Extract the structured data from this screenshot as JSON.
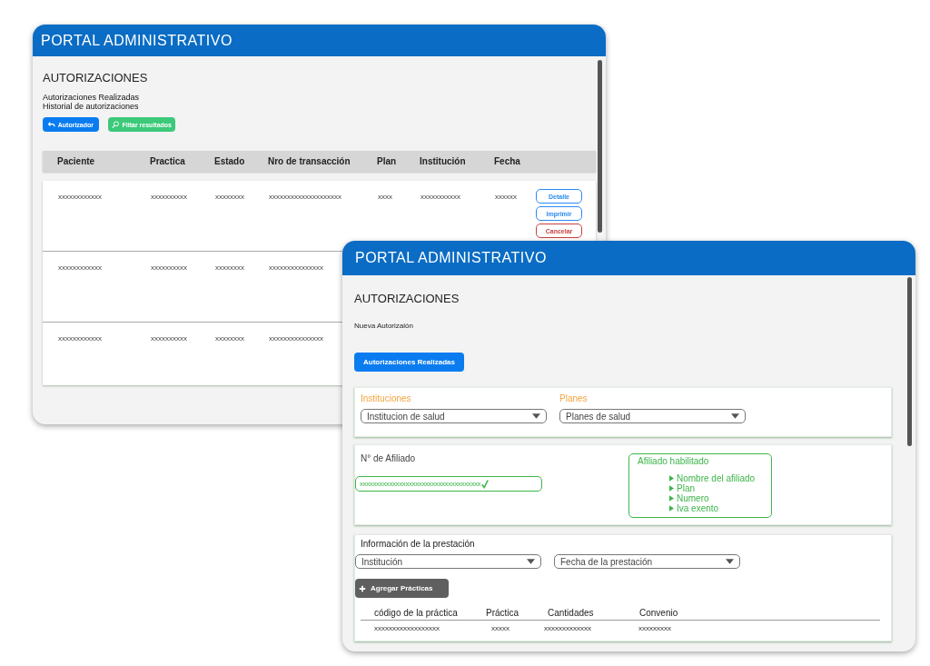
{
  "historial_window": {
    "title": "PORTAL ADMINISTRATIVO",
    "heading": "AUTORIZACIONES",
    "links": [
      "Autorizaciones Realizadas",
      "Historial de autorizaciones"
    ],
    "buttons": [
      {
        "label": "Autorizador",
        "kind": "primary"
      },
      {
        "label": "Filtar resultados",
        "kind": "success"
      }
    ],
    "table": {
      "columns": [
        "Paciente",
        "Practica",
        "Estado",
        "Nro de transacción",
        "Plan",
        "Institución",
        "Fecha"
      ],
      "rows": [
        {
          "cells": [
            "xxxxxxxxxxxx",
            "xxxxxxxxxx",
            "xxxxxxxx",
            "xxxxxxxxxxxxxxxxxxxx",
            "xxxx",
            "xxxxxxxxxxx",
            "xxxxxx"
          ],
          "actions": [
            {
              "label": "Detalle",
              "kind": "info"
            },
            {
              "label": "Imprimir",
              "kind": "info"
            },
            {
              "label": "Cancelar",
              "kind": "danger"
            }
          ]
        },
        {
          "cells": [
            "xxxxxxxxxxxx",
            "xxxxxxxxxx",
            "xxxxxxxx",
            "xxxxxxxxxxxxxxx"
          ]
        },
        {
          "cells": [
            "xxxxxxxxxxxx",
            "xxxxxxxxxx",
            "xxxxxxxx",
            "xxxxxxxxxxxxxxx"
          ]
        }
      ]
    }
  },
  "nueva_window": {
    "title": "PORTAL ADMINISTRATIVO",
    "heading": "AUTORIZACIONES",
    "subheading": "Nueva Autorizaión",
    "button": "Autorizaciones Realizadas",
    "selectors": [
      {
        "label": "Instituciones",
        "value": "Institucion de salud"
      },
      {
        "label": "Planes",
        "value": "Planes de salud"
      }
    ],
    "afiliado": {
      "label": "N° de Afiliado",
      "value": "xxxxxxxxxxxxxxxxxxxxxxxxxxxxxxxxxxxxx",
      "valid": true,
      "status_box": {
        "title": "Afiliado habilitado",
        "items": [
          "Nombre del afiliado",
          "Plan",
          "Numero",
          "Iva exento"
        ]
      }
    },
    "prestacion": {
      "title": "Información de la prestación",
      "selects": [
        "Institución",
        "Fecha de la prestación"
      ],
      "add_button": "Agregar Prácticas",
      "table": {
        "columns": [
          "código de la práctica",
          "Práctica",
          "Cantidades",
          "Convenio"
        ],
        "rows": [
          [
            "xxxxxxxxxxxxxxxxxx",
            "xxxxx",
            "xxxxxxxxxxxxx",
            "xxxxxxxxx"
          ]
        ]
      }
    }
  }
}
